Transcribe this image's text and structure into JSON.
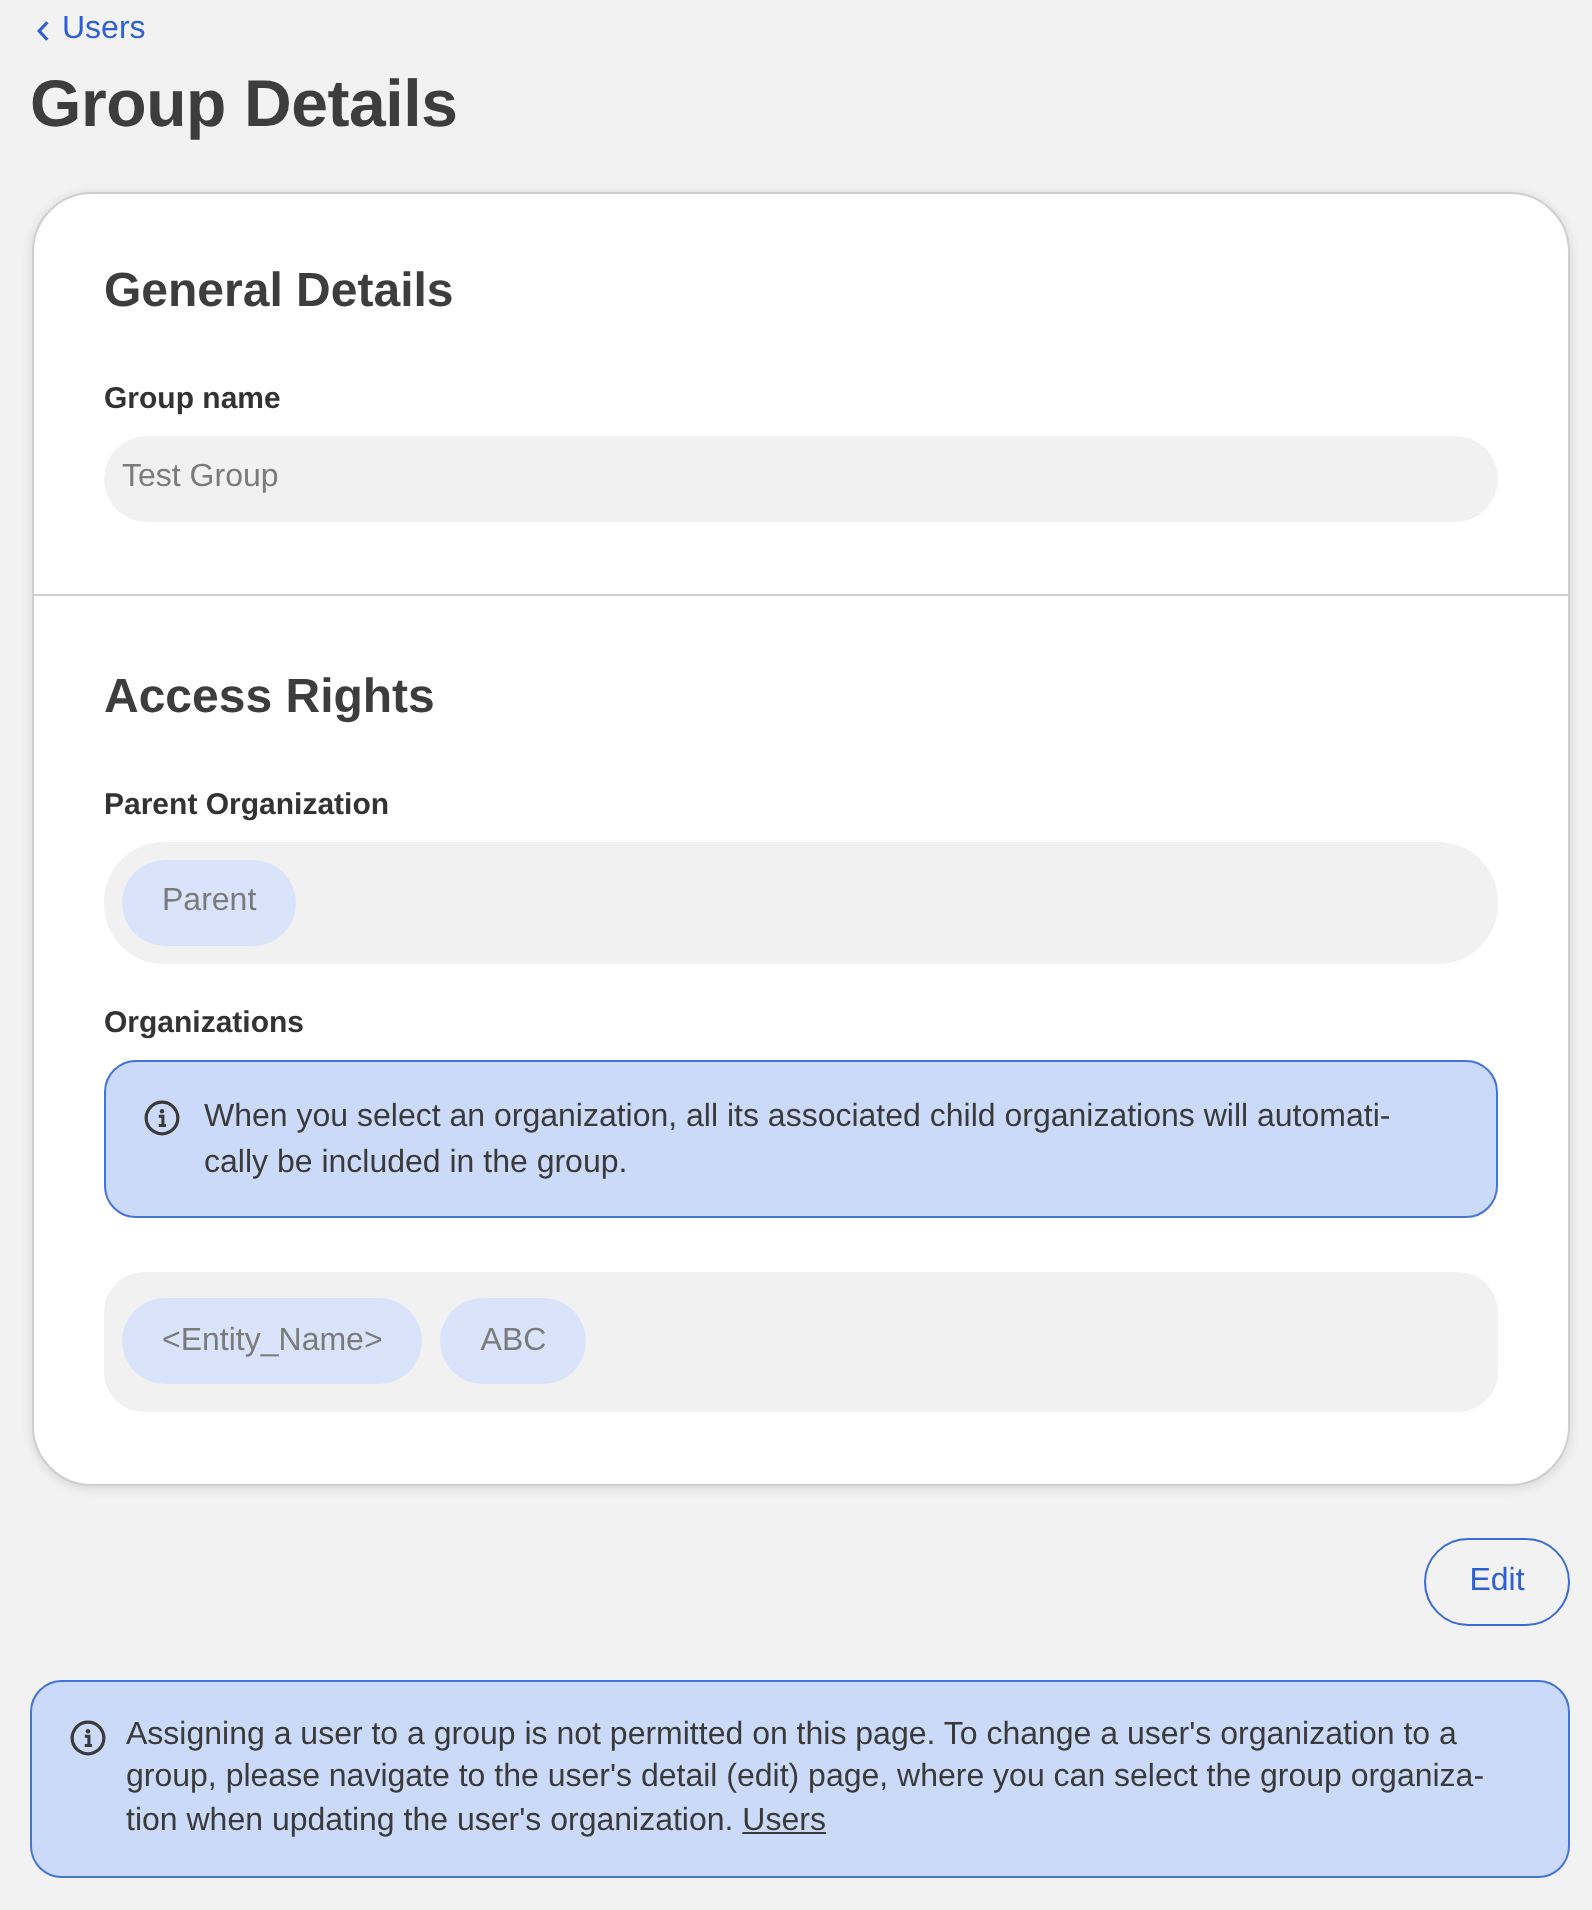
{
  "back_link": {
    "label": "Users"
  },
  "page_title": "Group Details",
  "sections": [
    {
      "title": "General Details",
      "fields": [
        {
          "kind": "text",
          "label": "Group name",
          "value": "Test Group"
        }
      ]
    },
    {
      "title": "Access Rights",
      "fields": [
        {
          "kind": "chips",
          "label": "Parent Organization",
          "chips": [
            "Parent"
          ]
        },
        {
          "kind": "chips",
          "label": "Organizations",
          "notice": "When you select an organization, all its associated child organizations will automati-cally be included in the group.",
          "chips": [
            "<Entity_Name>",
            "ABC"
          ]
        }
      ]
    }
  ],
  "edit_button": {
    "label": "Edit"
  },
  "footer_notice": {
    "text": "Assigning a user to a group is not permitted on this page. To change a user's organization to a group, please navigate to the user's detail (edit) page, where you can select the group organiza-tion when updating the user's organization.",
    "link": "Users"
  }
}
